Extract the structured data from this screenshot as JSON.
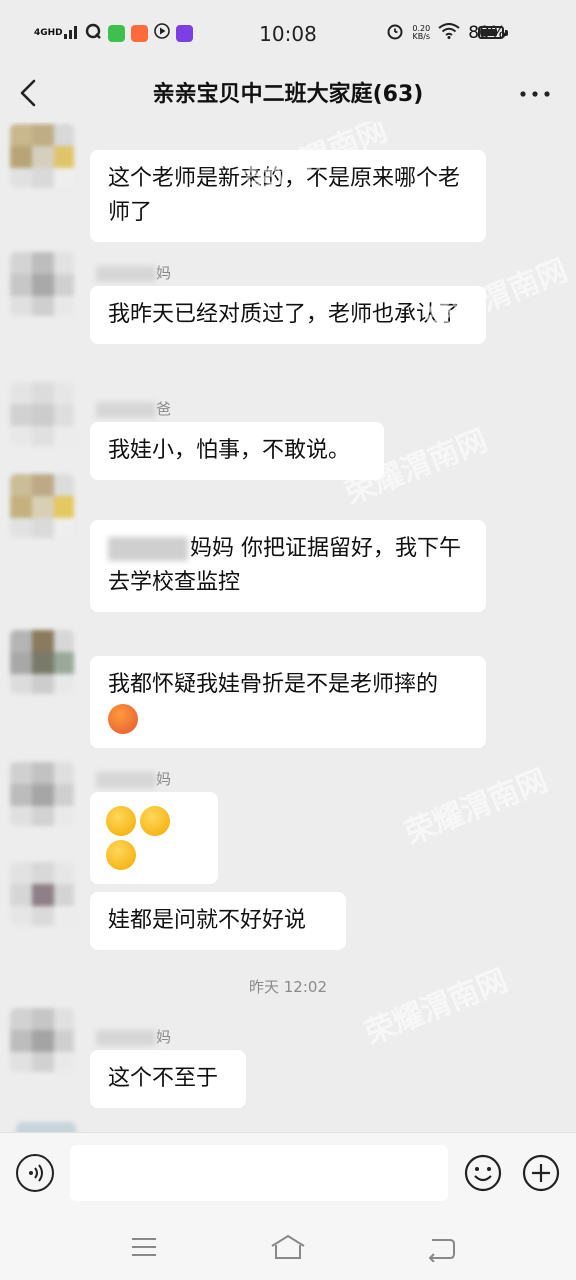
{
  "status_bar": {
    "network": "4GHD",
    "time": "10:08",
    "speed_value": "0.20",
    "speed_unit": "KB/s",
    "battery": "80%",
    "battery_level": 0.8
  },
  "header": {
    "title": "亲亲宝贝中二班大家庭(63)"
  },
  "messages": [
    {
      "sender": "",
      "text": "这个老师是新来的，不是原来哪个老师了"
    },
    {
      "sender": "妈",
      "text": "我昨天已经对质过了，老师也承认了"
    },
    {
      "sender": "爸",
      "text": "我娃小，怕事，不敢说。"
    },
    {
      "sender": "",
      "text_prefix_redacted": true,
      "text": "妈妈  你把证据留好，我下午去学校查监控"
    },
    {
      "sender": "",
      "text": "我都怀疑我娃骨折是不是老师摔的"
    },
    {
      "sender": "妈",
      "text": ""
    },
    {
      "sender": "",
      "text": "娃都是问就不好好说"
    },
    {
      "sender": "妈",
      "text": "这个不至于"
    }
  ],
  "time_separator": "昨天 12:02",
  "watermark": "荣耀渭南网",
  "input": {
    "placeholder": ""
  },
  "colors": {
    "background": "#ededed",
    "bubble": "#ffffff",
    "time_text": "#8a8a8a"
  }
}
